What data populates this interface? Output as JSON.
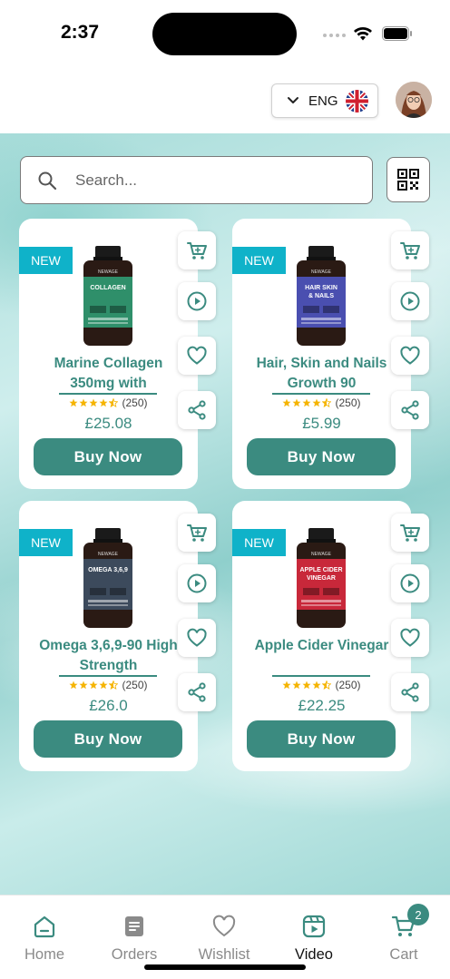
{
  "status_bar": {
    "time": "2:37"
  },
  "header": {
    "language_label": "ENG",
    "flag_icon": "uk-flag-icon",
    "avatar_icon": "user-avatar"
  },
  "search": {
    "placeholder": "Search..."
  },
  "products": [
    {
      "badge": "NEW",
      "name": "Marine Collagen 350mg with",
      "rating_count": "(250)",
      "price": "£25.08",
      "buy_label": "Buy Now",
      "label_text": "COLLAGEN",
      "label_color": "#2f8f6a",
      "rating": 4.5
    },
    {
      "badge": "NEW",
      "name": "Hair, Skin and Nails Growth 90",
      "rating_count": "(250)",
      "price": "£5.99",
      "buy_label": "Buy Now",
      "label_text": "HAIR SKIN & NAILS",
      "label_color": "#4a4fb0",
      "rating": 4.5
    },
    {
      "badge": "NEW",
      "name": "Omega 3,6,9-90 High Strength",
      "rating_count": "(250)",
      "price": "£26.0",
      "buy_label": "Buy Now",
      "label_text": "OMEGA 3,6,9",
      "label_color": "#3c4a5c",
      "rating": 4.5
    },
    {
      "badge": "NEW",
      "name": "Apple Cider Vinegar",
      "rating_count": "(250)",
      "price": "£22.25",
      "buy_label": "Buy Now",
      "label_text": "APPLE CIDER VINEGAR",
      "label_color": "#c8283a",
      "rating": 4.5
    }
  ],
  "card_actions": [
    "cart-icon",
    "play-icon",
    "heart-icon",
    "share-icon"
  ],
  "bottom_nav": {
    "items": [
      {
        "label": "Home",
        "icon": "home-icon"
      },
      {
        "label": "Orders",
        "icon": "orders-icon"
      },
      {
        "label": "Wishlist",
        "icon": "heart-icon"
      },
      {
        "label": "Video",
        "icon": "video-icon"
      },
      {
        "label": "Cart",
        "icon": "cart-icon"
      }
    ],
    "active": "Video",
    "cart_count": "2"
  },
  "colors": {
    "accent": "#3b8b80",
    "badge": "#0fb2c9"
  }
}
